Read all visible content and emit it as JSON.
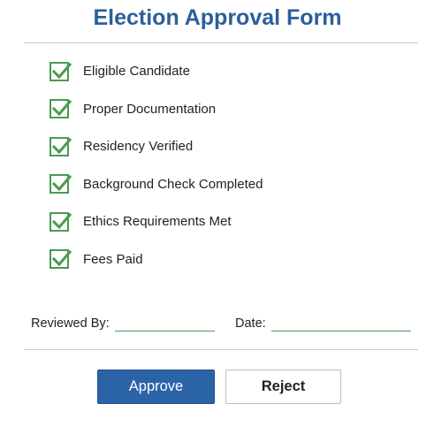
{
  "form": {
    "title": "Election Approval Form",
    "checklist": [
      {
        "label": "Eligible Candidate",
        "checked": true
      },
      {
        "label": "Proper Documentation",
        "checked": true
      },
      {
        "label": "Residency Verified",
        "checked": true
      },
      {
        "label": "Background Check Completed",
        "checked": true
      },
      {
        "label": "Ethics Requirements Met",
        "checked": true
      },
      {
        "label": "Fees Paid",
        "checked": true
      }
    ],
    "reviewed_by_label": "Reviewed By:",
    "reviewed_by_value": "",
    "date_label": "Date:",
    "date_value": "",
    "approve_label": "Approve",
    "reject_label": "Reject"
  },
  "colors": {
    "title": "#2b5f9a",
    "checkmark": "#4a9a4f",
    "approve_button": "#2b63a7"
  },
  "icons": {
    "checkbox": "checkmark-icon"
  }
}
